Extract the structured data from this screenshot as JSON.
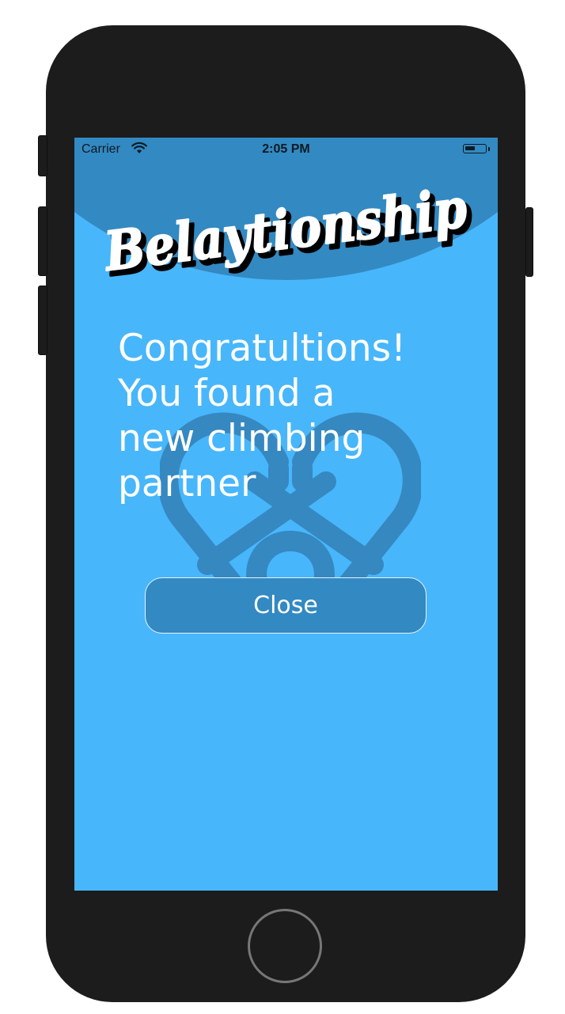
{
  "status_bar": {
    "carrier": "Carrier",
    "time": "2:05 PM",
    "battery_level": 0.5,
    "wifi_icon": "wifi-icon",
    "battery_icon": "battery-icon"
  },
  "app": {
    "logo_text": "Belaytionship",
    "watermark_icon": "heart-carabiner-icon"
  },
  "message": {
    "lines": [
      "Congratultions!",
      "You found a",
      "new climbing",
      "partner"
    ]
  },
  "actions": {
    "close_label": "Close"
  },
  "device": {
    "home_button_icon": "home-button-icon"
  },
  "colors": {
    "background": "#48b6fb",
    "header_band": "#3389c1",
    "button": "#3389c1",
    "text": "#ffffff",
    "device_frame": "#1c1c1c"
  }
}
